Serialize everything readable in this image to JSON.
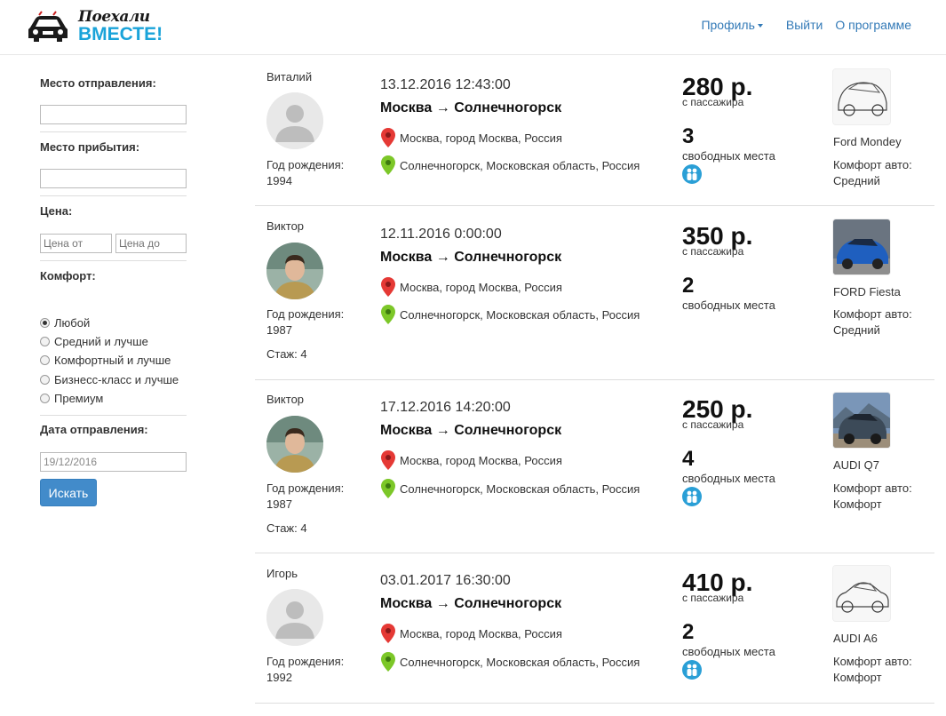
{
  "brand": {
    "line1": "Поехали",
    "line2": "ВМЕСТЕ!"
  },
  "nav": {
    "profile": "Профиль",
    "logout": "Выйти",
    "about": "О программе"
  },
  "filters": {
    "from_label": "Место отправления:",
    "from_value": "",
    "to_label": "Место прибытия:",
    "to_value": "",
    "price_label": "Цена:",
    "price_from_placeholder": "Цена от",
    "price_to_placeholder": "Цена до",
    "comfort_label": "Комфорт:",
    "comfort_options": [
      "Любой",
      "Средний и лучше",
      "Комфортный и лучше",
      "Бизнесс-класс и лучше",
      "Премиум"
    ],
    "comfort_selected": "Любой",
    "date_label": "Дата отправления:",
    "date_value": "19/12/2016",
    "search_button": "Искать"
  },
  "rides": [
    {
      "driver": "Виталий",
      "birth_label": "Год рождения:",
      "birth_year": "1994",
      "experience": "",
      "date": "13.12.2016 12:43:00",
      "route": "Москва → Солнечногорск",
      "from": "Москва, город Москва, Россия",
      "to": "Солнечногорск, Московская область, Россия",
      "price": "280 р.",
      "price_note": "с пассажира",
      "seats": "3",
      "seats_label": "свободных места",
      "car": "Ford Mondey",
      "comfort_label": "Комфорт авто:",
      "comfort": "Средний"
    },
    {
      "driver": "Виктор",
      "birth_label": "Год рождения:",
      "birth_year": "1987",
      "experience": "Стаж: 4",
      "date": "12.11.2016 0:00:00",
      "route": "Москва → Солнечногорск",
      "from": "Москва, город Москва, Россия",
      "to": "Солнечногорск, Московская область, Россия",
      "price": "350 р.",
      "price_note": "с пассажира",
      "seats": "2",
      "seats_label": "свободных места",
      "car": "FORD Fiesta",
      "comfort_label": "Комфорт авто:",
      "comfort": "Средний"
    },
    {
      "driver": "Виктор",
      "birth_label": "Год рождения:",
      "birth_year": "1987",
      "experience": "Стаж: 4",
      "date": "17.12.2016 14:20:00",
      "route": "Москва → Солнечногорск",
      "from": "Москва, город Москва, Россия",
      "to": "Солнечногорск, Московская область, Россия",
      "price": "250 р.",
      "price_note": "с пассажира",
      "seats": "4",
      "seats_label": "свободных места",
      "car": "AUDI Q7",
      "comfort_label": "Комфорт авто:",
      "comfort": "Комфорт"
    },
    {
      "driver": "Игорь",
      "birth_label": "Год рождения:",
      "birth_year": "1992",
      "experience": "",
      "date": "03.01.2017 16:30:00",
      "route": "Москва → Солнечногорск",
      "from": "Москва, город Москва, Россия",
      "to": "Солнечногорск, Московская область, Россия",
      "price": "410 р.",
      "price_note": "с пассажира",
      "seats": "2",
      "seats_label": "свободных места",
      "car": "AUDI A6",
      "comfort_label": "Комфорт авто:",
      "comfort": "Комфорт"
    }
  ],
  "colors": {
    "link": "#337ab7",
    "button": "#428bca",
    "pin_from": "#e53935",
    "pin_to": "#7cc728",
    "logo_blue": "#1aa3d9"
  },
  "icons": {
    "from_pin": "map-pin-red-icon",
    "to_pin": "map-pin-green-icon",
    "passengers": "passengers-icon"
  }
}
